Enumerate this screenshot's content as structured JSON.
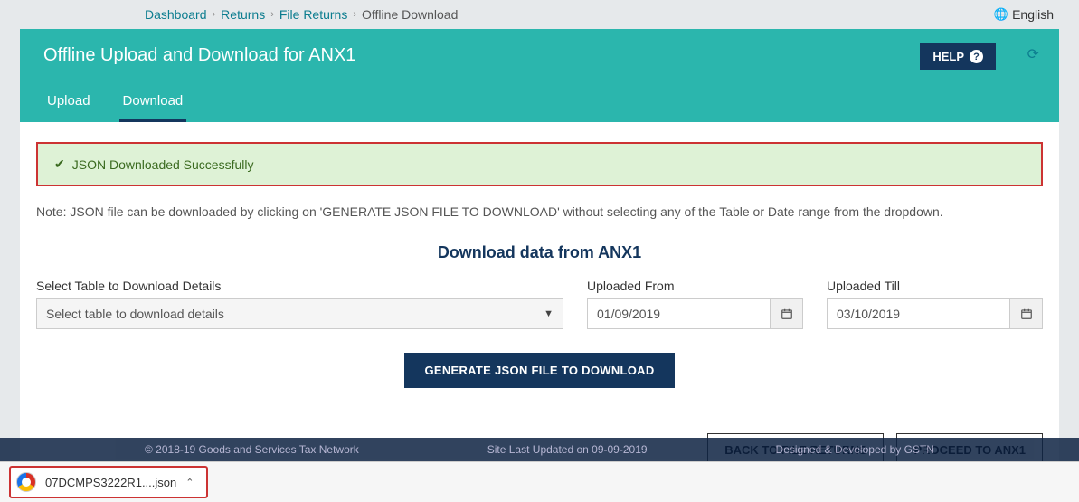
{
  "breadcrumb": {
    "items": [
      "Dashboard",
      "Returns",
      "File Returns"
    ],
    "current": "Offline Download"
  },
  "language": "English",
  "hero": {
    "title": "Offline Upload and Download for ANX1",
    "help_label": "HELP"
  },
  "tabs": {
    "upload": "Upload",
    "download": "Download"
  },
  "alert": {
    "text": "JSON Downloaded Successfully"
  },
  "note": "Note: JSON file can be downloaded by clicking on 'GENERATE JSON FILE TO DOWNLOAD' without selecting any of the Table or Date range from the dropdown.",
  "section_title": "Download data from ANX1",
  "form": {
    "table_label": "Select Table to Download Details",
    "table_placeholder": "Select table to download details",
    "from_label": "Uploaded From",
    "from_value": "01/09/2019",
    "till_label": "Uploaded Till",
    "till_value": "03/10/2019"
  },
  "buttons": {
    "generate": "GENERATE JSON FILE TO DOWNLOAD",
    "back": "BACK TO FILE RETURNS",
    "proceed": "PROCEED TO ANX1"
  },
  "footer": {
    "left": "© 2018-19 Goods and Services Tax Network",
    "mid": "Site Last Updated on 09-09-2019",
    "right": "Designed & Developed by GSTN"
  },
  "download_chip": {
    "filename": "07DCMPS3222R1....json"
  }
}
